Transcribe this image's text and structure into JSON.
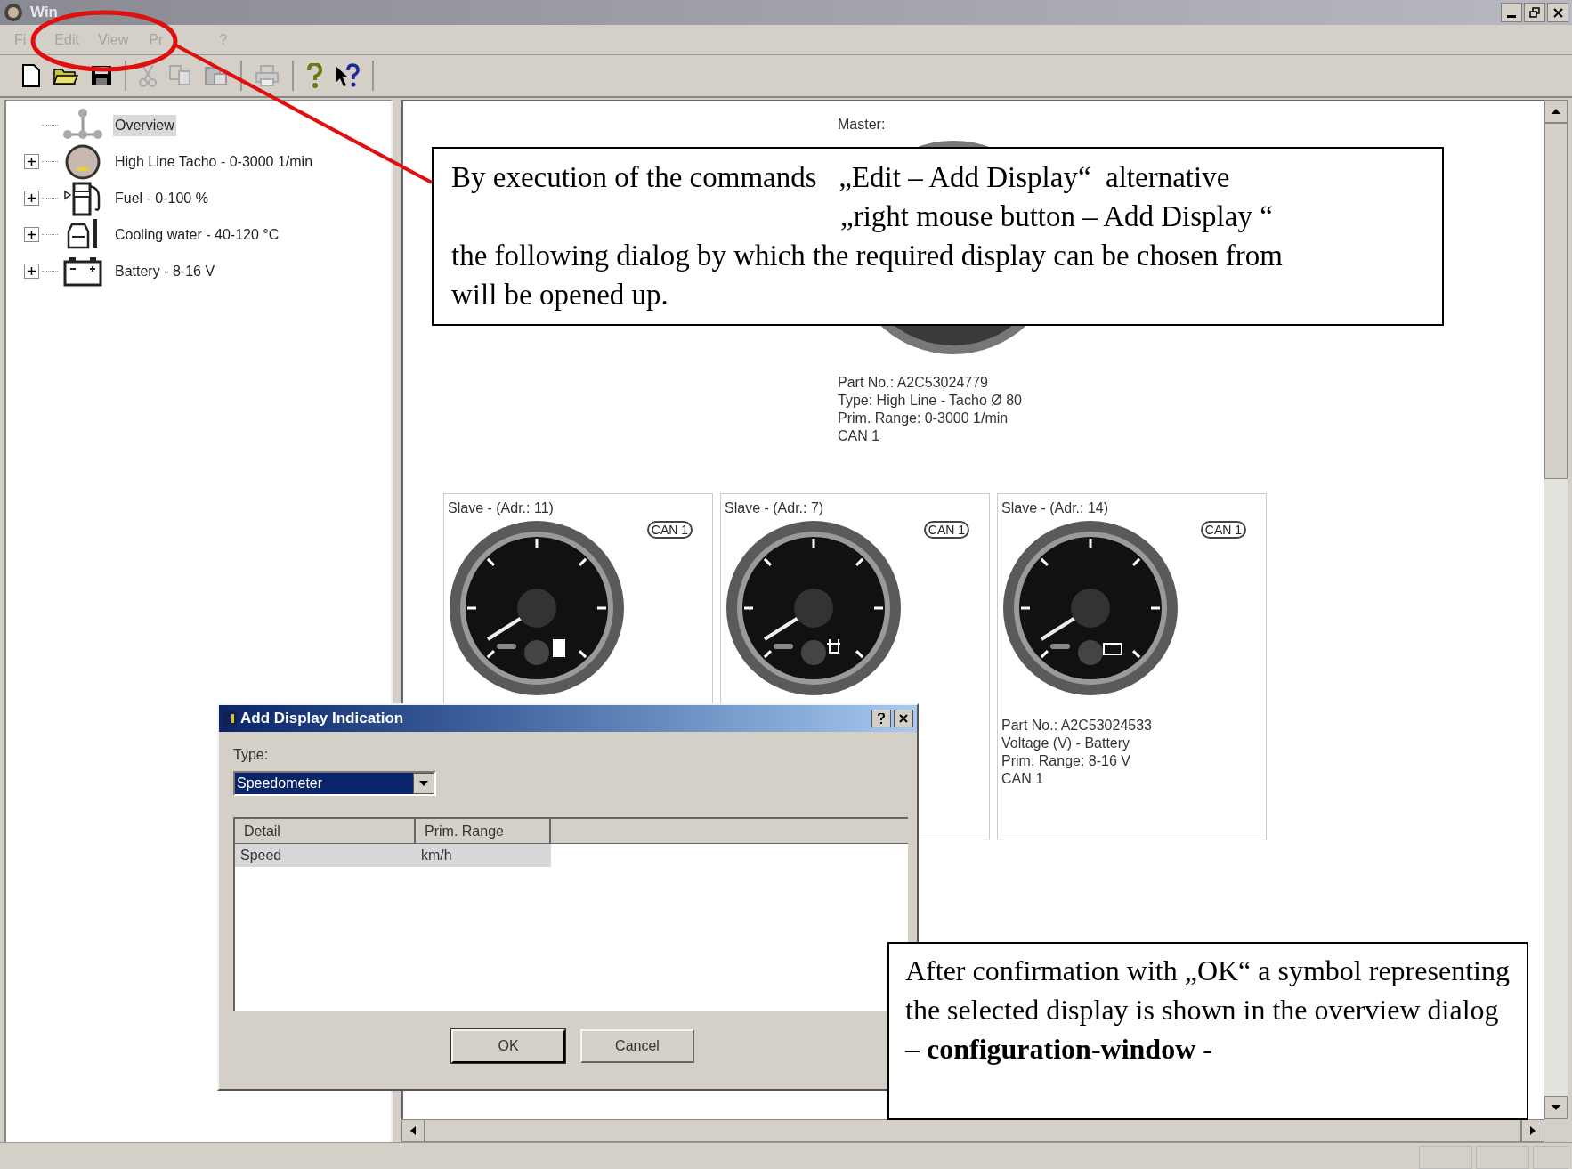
{
  "window": {
    "title": "Win"
  },
  "menu": [
    {
      "label": "Fi"
    },
    {
      "label": "Edit"
    },
    {
      "label": "View"
    },
    {
      "label": "Pr"
    },
    {
      "label": "?"
    }
  ],
  "tree": {
    "label": "Overview",
    "kind": "overview",
    "selected": true,
    "children": [
      {
        "label": "High Line Tacho - 0-3000 1/min",
        "kind": "tacho",
        "expanded": false,
        "selected": false
      },
      {
        "label": "Fuel - 0-100 %",
        "kind": "fuel",
        "expanded": false,
        "selected": false
      },
      {
        "label": "Cooling water - 40-120 °C",
        "kind": "coolant",
        "expanded": false,
        "selected": false
      },
      {
        "label": "Battery - 8-16 V",
        "kind": "battery",
        "expanded": false,
        "selected": false
      }
    ]
  },
  "master": {
    "heading": "Master:",
    "details": [
      "Part No.: A2C53024779",
      "Type: High Line - Tacho Ø 80",
      "Prim. Range: 0-3000 1/min",
      "CAN 1"
    ]
  },
  "slaves": [
    {
      "heading": "Slave - (Adr.: 11)",
      "badge": "CAN 1",
      "kind": "fuel"
    },
    {
      "heading": "Slave - (Adr.: 7)",
      "badge": "CAN 1",
      "kind": "coolant"
    },
    {
      "heading": "Slave - (Adr.: 14)",
      "badge": "CAN 1",
      "kind": "battery",
      "details": [
        "Part No.: A2C53024533",
        "Voltage (V) - Battery",
        "Prim. Range: 8-16 V",
        "CAN 1"
      ]
    }
  ],
  "dialog": {
    "title": "Add Display Indication",
    "type_label": "Type:",
    "type_value": "Speedometer",
    "columns": [
      "Detail",
      "Prim. Range"
    ],
    "rows": [
      {
        "cells": [
          "Speed",
          "km/h"
        ],
        "selected": true
      }
    ],
    "buttons": [
      {
        "label": "OK",
        "default": true
      },
      {
        "label": "Cancel",
        "default": false
      }
    ]
  },
  "callouts": [
    {
      "lines": [
        "By execution of the commands   „Edit – Add Display“  alternative",
        "„right mouse button – Add Display “",
        "the following dialog by which the required display can be chosen from",
        "will be opened up."
      ]
    },
    {
      "lines": [
        "After confirmation with „OK“ a symbol representing the selected display is shown in the overview dialog  – **configuration-window -**"
      ]
    }
  ]
}
